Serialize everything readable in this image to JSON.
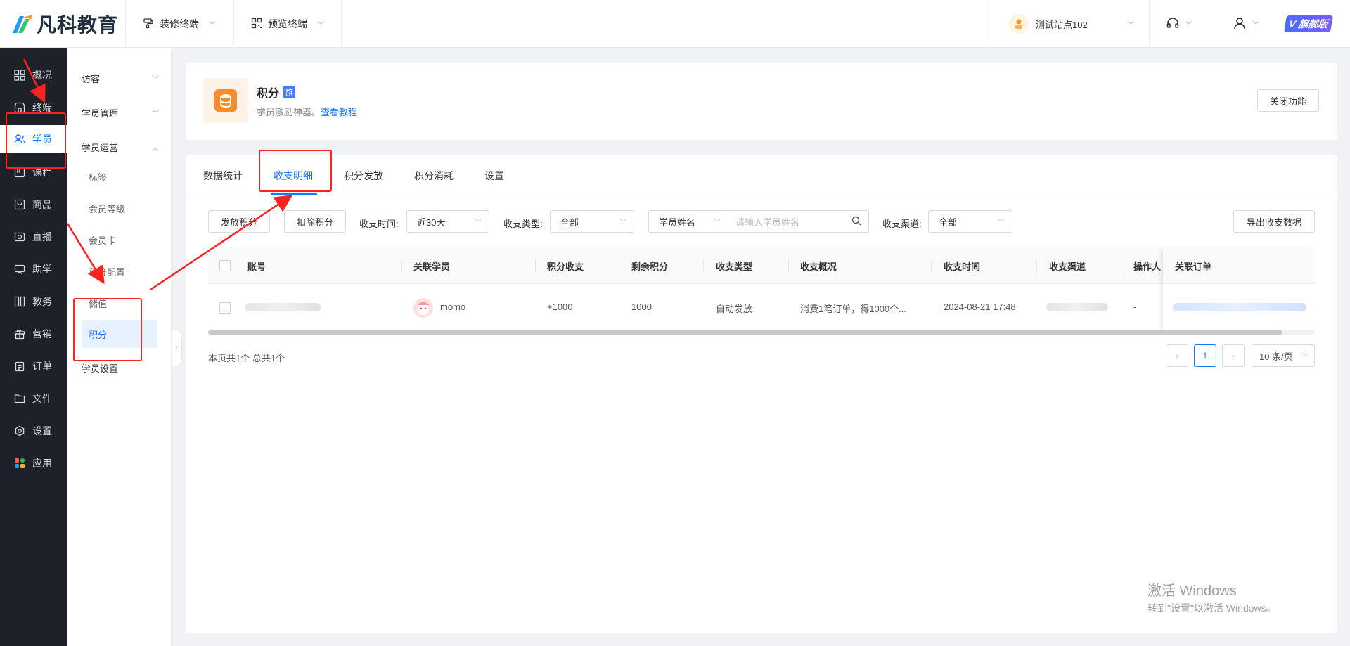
{
  "header": {
    "brand": "凡科教育",
    "nav": [
      {
        "label": "装修终端",
        "icon": "paint-roller-icon"
      },
      {
        "label": "预览终端",
        "icon": "qrcode-icon"
      }
    ],
    "site_name": "测试站点102",
    "edition_badge": "旗舰版"
  },
  "sidebar": {
    "items": [
      {
        "label": "概况",
        "icon": "grid-icon"
      },
      {
        "label": "终端",
        "icon": "store-icon"
      },
      {
        "label": "学员",
        "icon": "users-icon"
      },
      {
        "label": "课程",
        "icon": "book-icon"
      },
      {
        "label": "商品",
        "icon": "bag-icon"
      },
      {
        "label": "直播",
        "icon": "camera-icon"
      },
      {
        "label": "助学",
        "icon": "assist-icon"
      },
      {
        "label": "教务",
        "icon": "columns-icon"
      },
      {
        "label": "营销",
        "icon": "gift-icon"
      },
      {
        "label": "订单",
        "icon": "clipboard-icon"
      },
      {
        "label": "文件",
        "icon": "folder-icon"
      },
      {
        "label": "设置",
        "icon": "gear-icon"
      },
      {
        "label": "应用",
        "icon": "apps-icon"
      }
    ]
  },
  "subnav": {
    "groups": [
      "访客",
      "学员管理",
      "学员运营"
    ],
    "items": [
      "标签",
      "会员等级",
      "会员卡",
      "积分配置",
      "储值",
      "积分"
    ],
    "footer": "学员设置"
  },
  "feature": {
    "title": "积分",
    "flag": "旗",
    "desc": "学员激励神器。",
    "link": "查看教程",
    "close_btn": "关闭功能"
  },
  "tabs": [
    "数据统计",
    "收支明细",
    "积分发放",
    "积分消耗",
    "设置"
  ],
  "filters": {
    "issue_btn": "发放积分",
    "deduct_btn": "扣除积分",
    "time_label": "收支时间:",
    "time_value": "近30天",
    "type_label": "收支类型:",
    "type_value": "全部",
    "name_select": "学员姓名",
    "name_placeholder": "请输入学员姓名",
    "channel_label": "收支渠道:",
    "channel_value": "全部",
    "export_btn": "导出收支数据"
  },
  "table": {
    "columns": [
      "账号",
      "关联学员",
      "积分收支",
      "剩余积分",
      "收支类型",
      "收支概况",
      "收支时间",
      "收支渠道",
      "操作人",
      "关联订单"
    ],
    "rows": [
      {
        "student": "momo",
        "change": "+1000",
        "remain": "1000",
        "type": "自动发放",
        "summary": "消费1笔订单，得1000个...",
        "time": "2024-08-21 17:48",
        "operator": "-"
      }
    ]
  },
  "pagination": {
    "summary": "本页共1个 总共1个",
    "current": "1",
    "page_size": "10 条/页"
  },
  "watermark": {
    "line1": "激活 Windows",
    "line2": "转到\"设置\"以激活 Windows。"
  },
  "colors": {
    "primary": "#1677ff",
    "sidebar_bg": "#1f2128",
    "annotation": "#ff2020"
  }
}
